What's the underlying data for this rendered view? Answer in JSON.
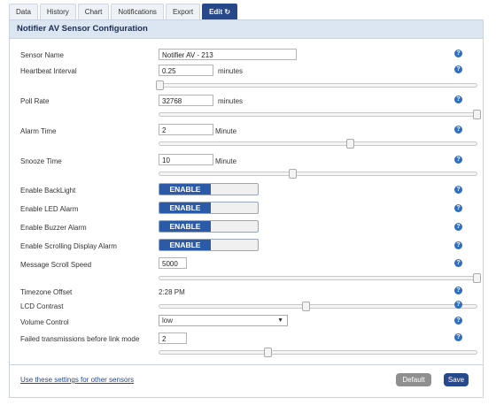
{
  "tabs": [
    {
      "label": "Data"
    },
    {
      "label": "History"
    },
    {
      "label": "Chart"
    },
    {
      "label": "Notifications"
    },
    {
      "label": "Export"
    },
    {
      "label": "Edit"
    }
  ],
  "edit_tab_icon": "refresh-icon",
  "panel_title": "Notifier AV Sensor Configuration",
  "fields": {
    "sensor_name": {
      "label": "Sensor Name",
      "value": "Notifier AV - 213"
    },
    "heartbeat": {
      "label": "Heartbeat Interval",
      "value": "0.25",
      "unit": "minutes",
      "slider_fraction": 0.0
    },
    "poll_rate": {
      "label": "Poll Rate",
      "value": "32768",
      "unit": "minutes",
      "slider_fraction": 1.0
    },
    "alarm_time": {
      "label": "Alarm Time",
      "value": "2",
      "unit": "Minute",
      "slider_fraction": 0.6
    },
    "snooze_time": {
      "label": "Snooze Time",
      "value": "10",
      "unit": "Minute",
      "slider_fraction": 0.42
    },
    "enable_backlight": {
      "label": "Enable BackLight",
      "state": "ENABLE"
    },
    "enable_led_alarm": {
      "label": "Enable LED Alarm",
      "state": "ENABLE"
    },
    "enable_buzzer_alarm": {
      "label": "Enable Buzzer Alarm",
      "state": "ENABLE"
    },
    "enable_scrolling_alarm": {
      "label": "Enable Scrolling Display Alarm",
      "state": "ENABLE"
    },
    "message_scroll_speed": {
      "label": "Message Scroll Speed",
      "value": "5000",
      "slider_fraction": 1.0
    },
    "timezone_offset": {
      "label": "Timezone Offset",
      "value": "2:28 PM"
    },
    "lcd_contrast": {
      "label": "LCD Contrast",
      "slider_fraction": 0.46
    },
    "volume_control": {
      "label": "Volume Control",
      "value": "low"
    },
    "failed_transmissions": {
      "label": "Failed transmissions before link mode",
      "value": "2",
      "slider_fraction": 0.34
    }
  },
  "footer": {
    "link": "Use these settings for other sensors",
    "default_label": "Default",
    "save_label": "Save"
  },
  "colors": {
    "accent": "#27488a",
    "toggle_on": "#2b5aa8",
    "help_icon": "#2f6fc1",
    "header_bg": "#dbe6f2"
  }
}
